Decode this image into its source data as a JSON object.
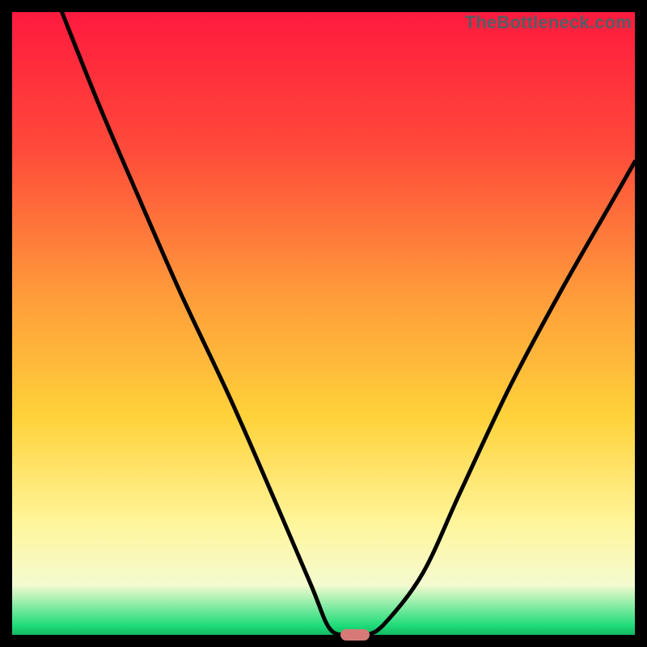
{
  "attribution": "TheBottleneck.com",
  "colors": {
    "bg": "#000000",
    "top": "#ff1a3e",
    "mid_upper": "#ff8a3a",
    "mid": "#ffd23a",
    "mid_lower": "#fff59a",
    "pale": "#f4fbcf",
    "green": "#1fdc7a",
    "curve": "#000000",
    "marker": "#d77a77"
  },
  "chart_data": {
    "type": "line",
    "title": "",
    "xlabel": "",
    "ylabel": "",
    "xlim": [
      0,
      100
    ],
    "ylim": [
      0,
      100
    ],
    "series": [
      {
        "name": "bottleneck-curve",
        "x": [
          8,
          14,
          20,
          27,
          35,
          42,
          48,
          51,
          54,
          57,
          60,
          66,
          72,
          80,
          88,
          96,
          100
        ],
        "y": [
          100,
          85,
          71,
          55,
          38,
          22,
          8,
          1,
          0,
          0,
          2,
          10,
          23,
          40,
          55,
          69,
          76
        ]
      }
    ],
    "marker": {
      "x": 55,
      "y": 0
    },
    "gradient_stops": [
      {
        "offset": 0.0,
        "color": "#ff1a3e"
      },
      {
        "offset": 0.22,
        "color": "#ff4a3a"
      },
      {
        "offset": 0.45,
        "color": "#ff9a3a"
      },
      {
        "offset": 0.65,
        "color": "#ffd23a"
      },
      {
        "offset": 0.82,
        "color": "#fff59a"
      },
      {
        "offset": 0.92,
        "color": "#f4fbcf"
      },
      {
        "offset": 0.985,
        "color": "#1fdc7a"
      },
      {
        "offset": 1.0,
        "color": "#12b862"
      }
    ]
  }
}
